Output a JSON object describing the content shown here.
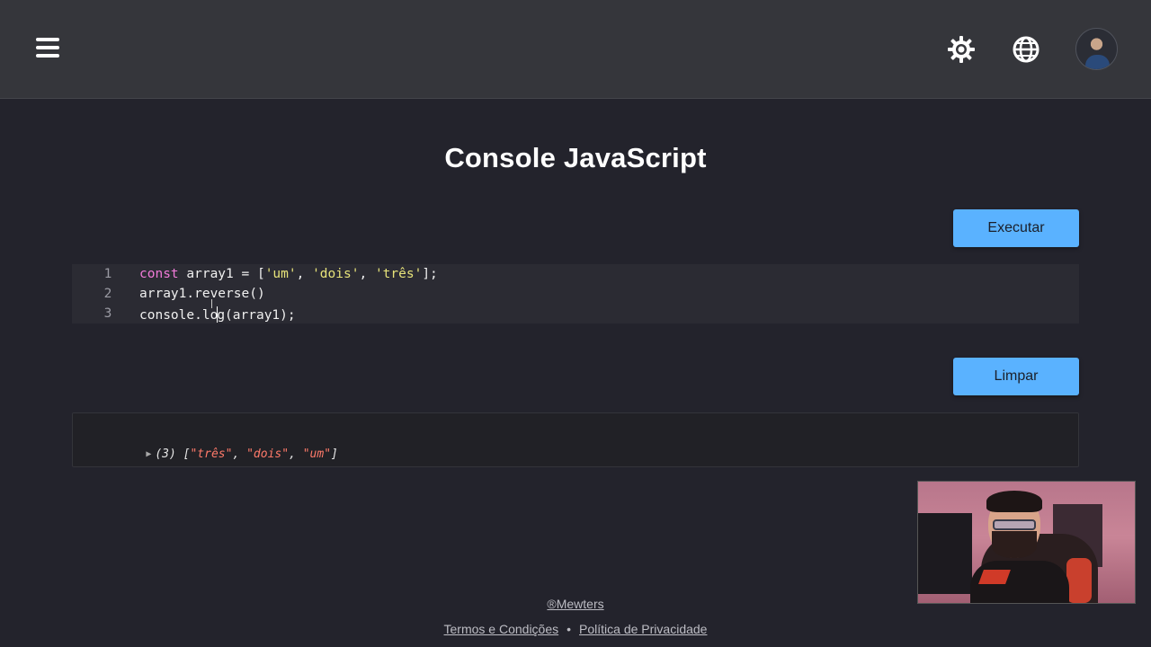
{
  "header": {
    "menu_icon": "hamburger-menu-icon",
    "theme_icon": "sun-gear-icon",
    "language_icon": "globe-icon",
    "avatar": "user-avatar"
  },
  "main": {
    "title": "Console JavaScript",
    "run_button": "Executar",
    "clear_button": "Limpar"
  },
  "editor": {
    "lines": [
      {
        "num": "1",
        "tokens": [
          {
            "t": "const",
            "c": "kw"
          },
          {
            "t": " array1 = [",
            "c": ""
          },
          {
            "t": "'um'",
            "c": "str"
          },
          {
            "t": ", ",
            "c": ""
          },
          {
            "t": "'dois'",
            "c": "str"
          },
          {
            "t": ", ",
            "c": ""
          },
          {
            "t": "'três'",
            "c": "str"
          },
          {
            "t": "];",
            "c": ""
          }
        ]
      },
      {
        "num": "2",
        "text": "array1.reverse()"
      },
      {
        "num": "3",
        "before_caret": "console.lo",
        "after_caret": "g(array1);"
      }
    ]
  },
  "console": {
    "count": "(3)",
    "open": " [",
    "items": [
      "\"três\"",
      "\"dois\"",
      "\"um\""
    ],
    "sep": ", ",
    "close": "]"
  },
  "footer": {
    "brand": "®Mewters",
    "terms": "Termos e Condições",
    "separator": "•",
    "privacy": "Política de Privacidade"
  },
  "colors": {
    "background": "#23232c",
    "topbar": "#35363b",
    "button": "#5ab2ff",
    "keyword": "#f27bd9",
    "string": "#e7e37a",
    "console_string": "#ff7a6a"
  }
}
